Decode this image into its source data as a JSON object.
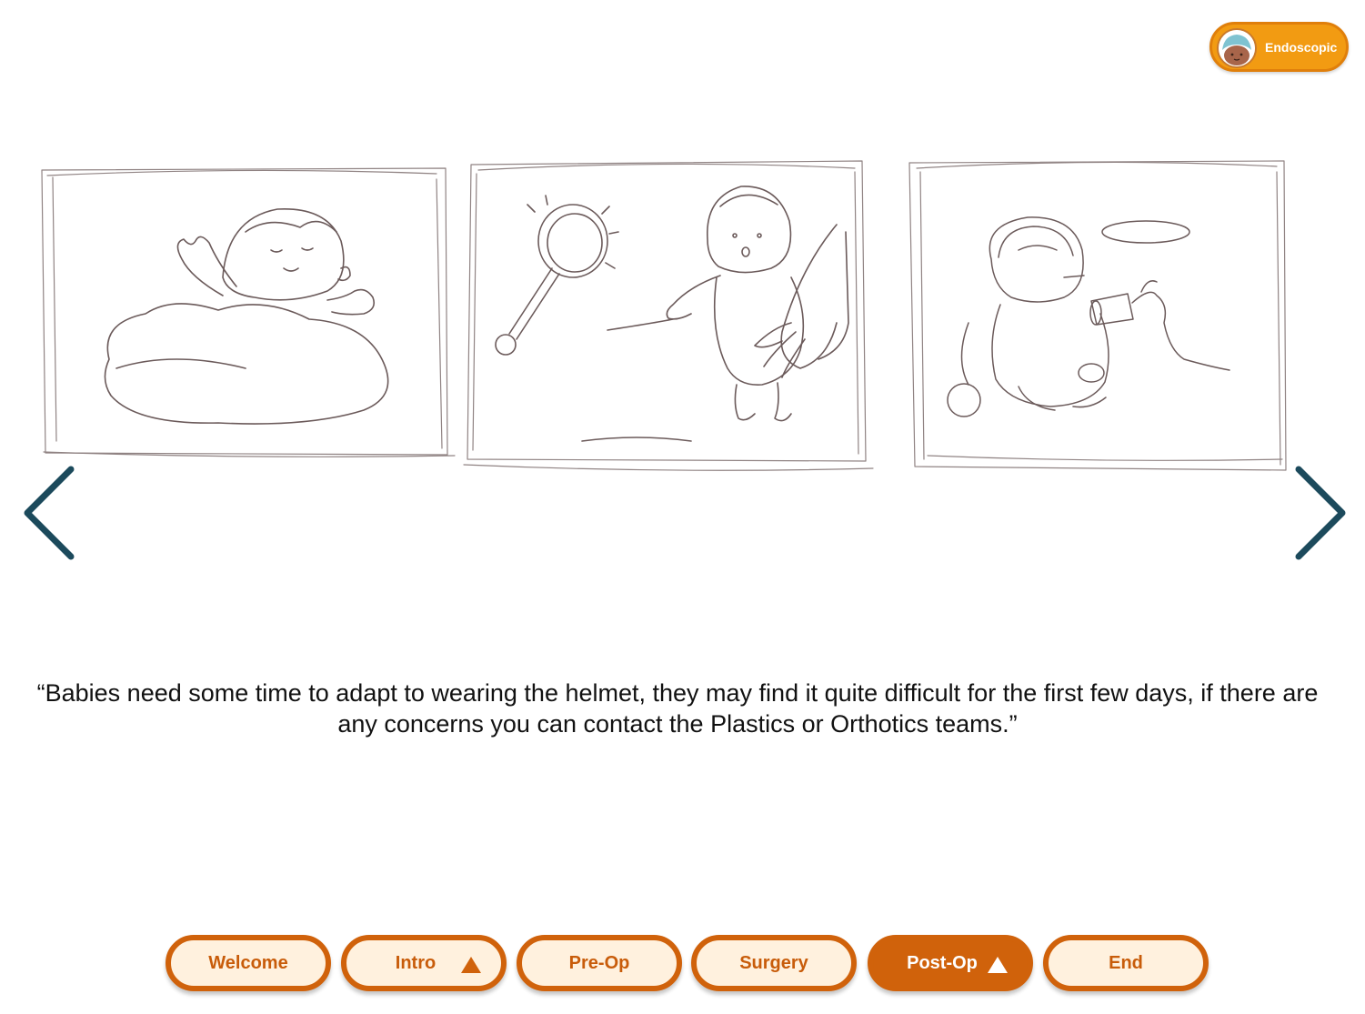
{
  "header": {
    "pathway_label": "Endoscopic",
    "pathway_icon": "baby-helmet-avatar-icon"
  },
  "navigation": {
    "prev_icon": "chevron-left-icon",
    "next_icon": "chevron-right-icon",
    "arrow_color": "#1c4a5c"
  },
  "storyboard": {
    "panels": [
      {
        "icon": "sleeping-baby-sketch"
      },
      {
        "icon": "baby-helmet-fitting-sketch"
      },
      {
        "icon": "baby-drinking-sketch"
      }
    ]
  },
  "caption": {
    "text": "“Babies need some time to adapt to wearing the helmet, they may find it quite difficult for the first few days,  if there are any concerns you can contact the Plastics or Orthotics teams.”"
  },
  "bottom_nav": {
    "items": [
      {
        "label": "Welcome",
        "active": false,
        "caret": false
      },
      {
        "label": "Intro",
        "active": false,
        "caret": true
      },
      {
        "label": "Pre-Op",
        "active": false,
        "caret": false
      },
      {
        "label": "Surgery",
        "active": false,
        "caret": false
      },
      {
        "label": "Post-Op",
        "active": true,
        "caret": true
      },
      {
        "label": "End",
        "active": false,
        "caret": false
      }
    ],
    "accent_color": "#d0620b",
    "pill_fill": "#fff1de"
  }
}
